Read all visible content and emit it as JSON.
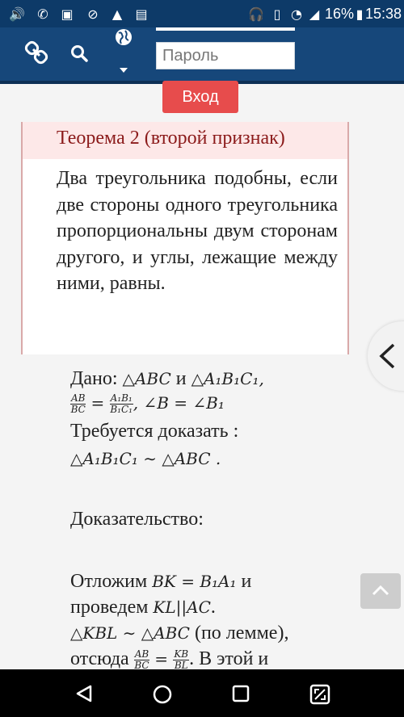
{
  "status_bar": {
    "battery_percent": "16%",
    "time": "15:38",
    "icons_left": [
      "volume-icon",
      "whatsapp-icon",
      "gallery-icon",
      "no-disturb-icon",
      "drive-icon",
      "sim-icon"
    ],
    "icons_right": [
      "headphones-icon",
      "vibrate-icon",
      "wifi-icon",
      "signal-icon",
      "battery-icon"
    ]
  },
  "header": {
    "password_placeholder": "Пароль",
    "login_label": "Вход"
  },
  "theorem": {
    "title": "Теорема 2 (второй признак)",
    "body": "Два треугольника подобны, если две стороны одного треугольника пропорциональны двум сторонам другого, и углы, лежащие между ними, равны."
  },
  "proof": {
    "given_label": "Дано:",
    "given_triangle1": "△ABC",
    "and_word": "и",
    "given_triangle2": "△A₁B₁C₁,",
    "ratio_left_num": "AB",
    "ratio_left_den": "BC",
    "ratio_right_num": "A₁B₁",
    "ratio_right_den": "B₁C₁",
    "angle_condition": ", ∠B = ∠B₁",
    "to_prove_label": "Требуется доказать :",
    "to_prove_statement": "△A₁B₁C₁ ∼ △ABC .",
    "proof_label": "Доказательство:",
    "step1_word": "Отложим",
    "step1_math": "BK = B₁A₁",
    "step1_tail": "и",
    "step2_word": "проведем",
    "step2_math": "KL||AC",
    "step2_tail": ".",
    "step3_math": "△KBL ∼ △ABC",
    "step3_tail": "(по лемме),",
    "step4_word": "отсюда",
    "step4_frac1_num": "AB",
    "step4_frac1_den": "BC",
    "step4_frac2_num": "KB",
    "step4_frac2_den": "BL",
    "step4_tail": ". В этой и"
  }
}
